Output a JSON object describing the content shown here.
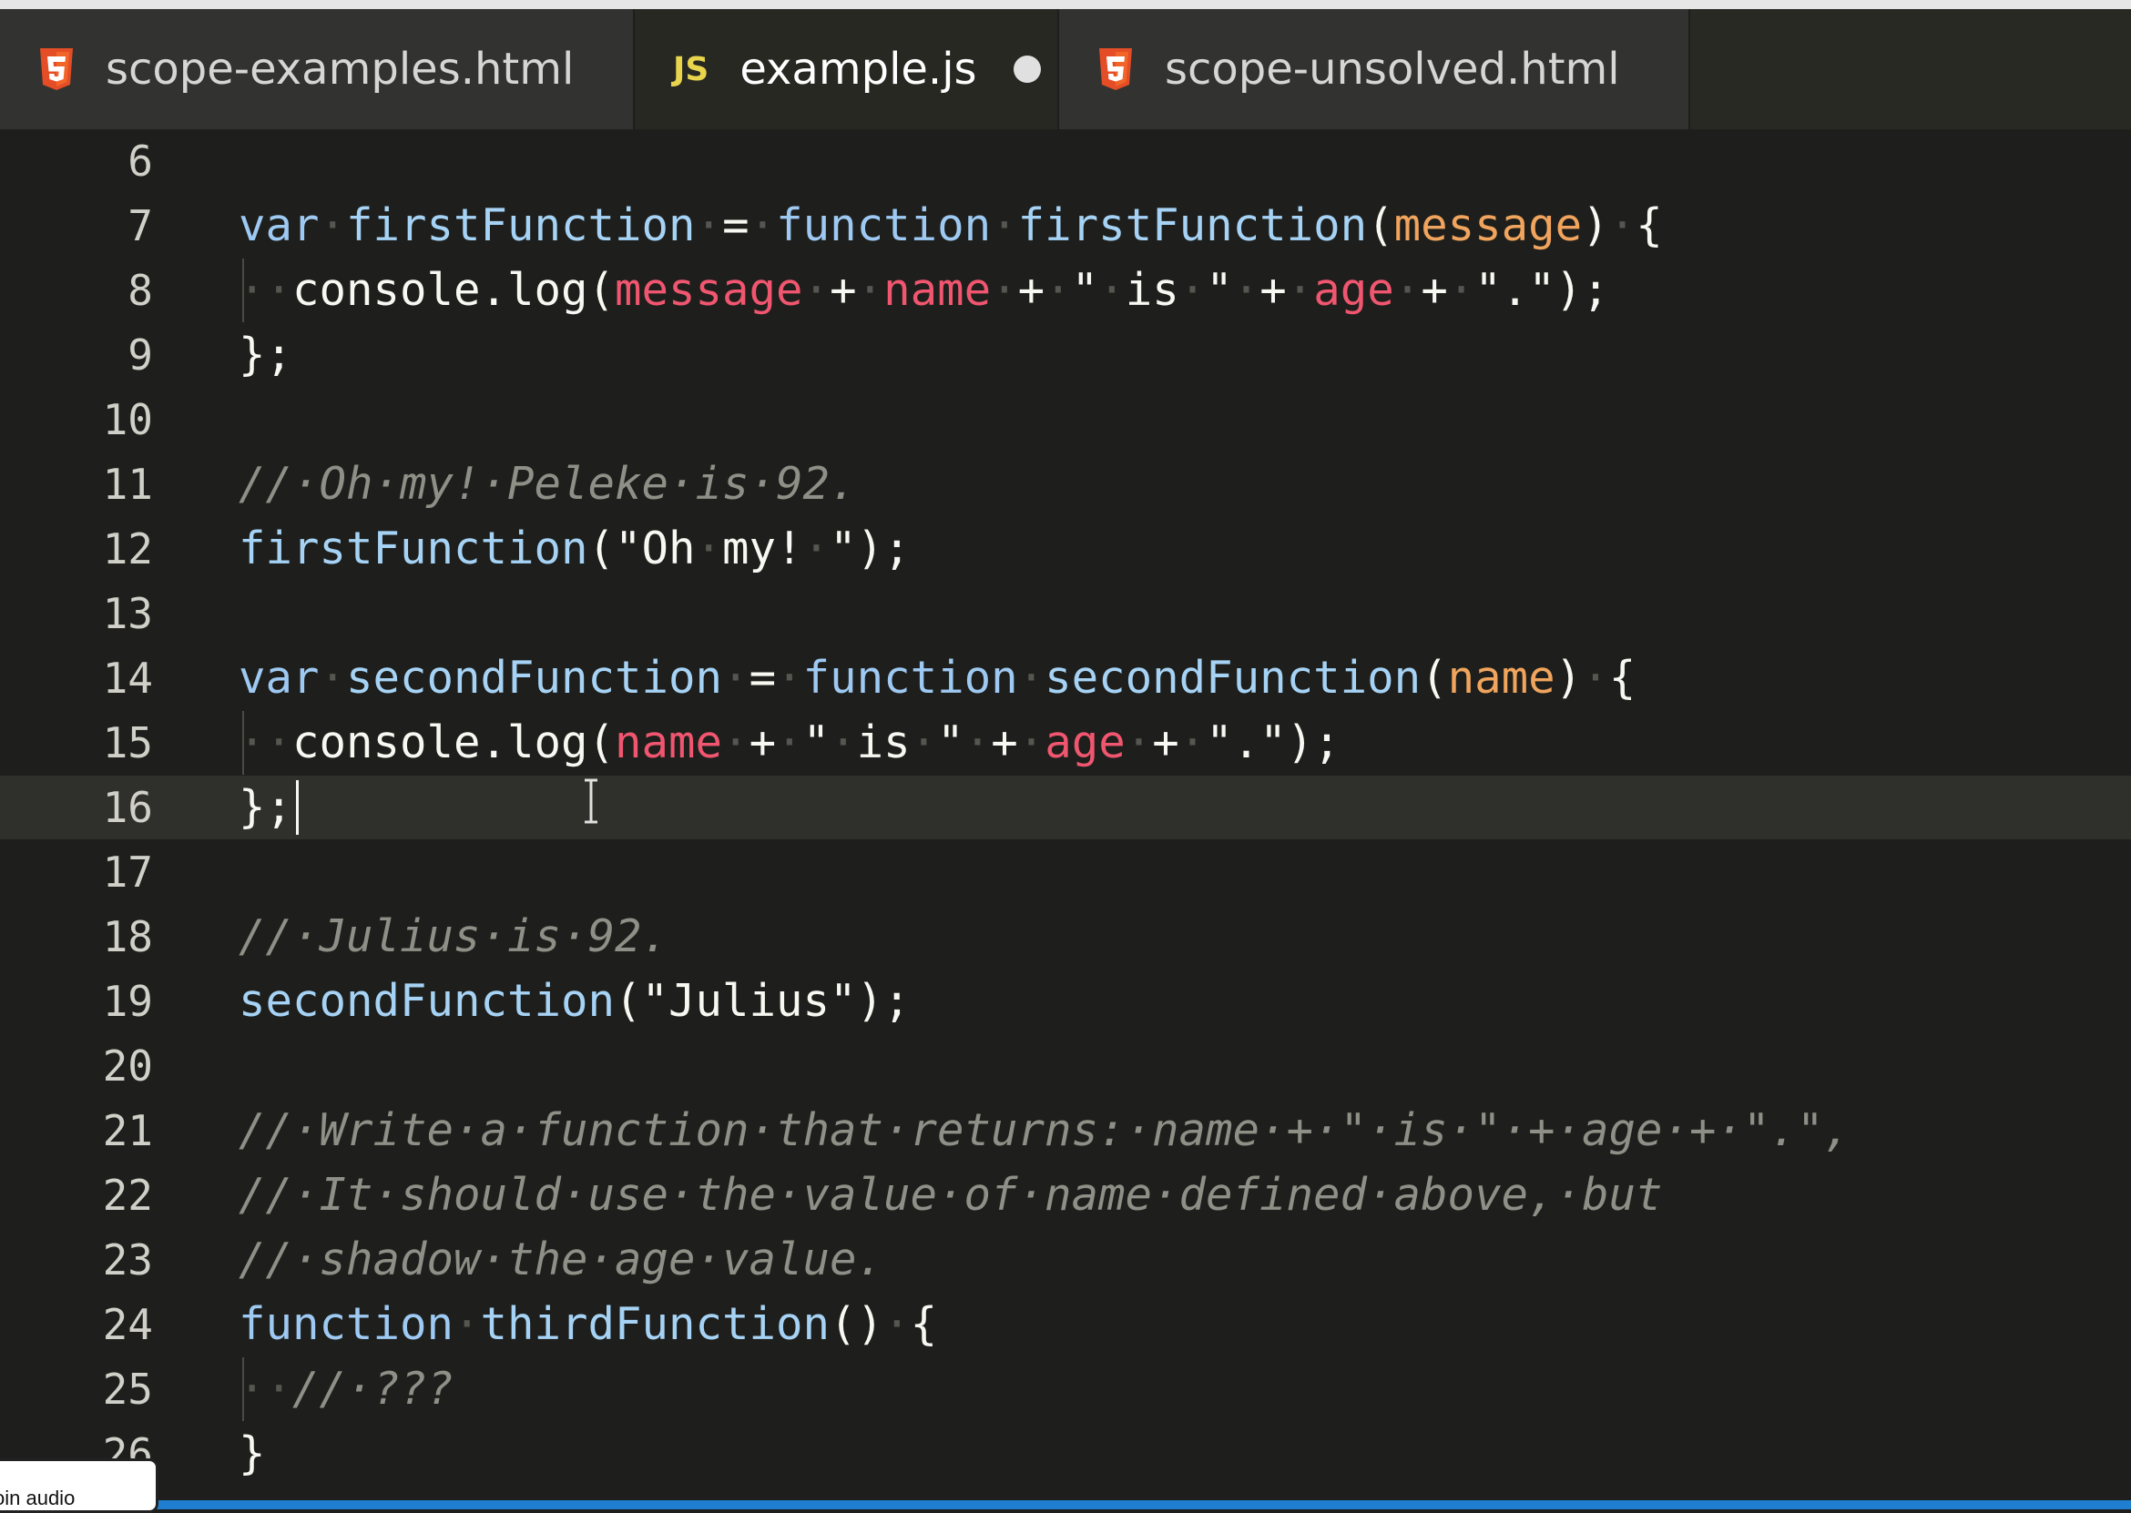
{
  "tabs": [
    {
      "label": "scope-examples.html",
      "icon": "html5-icon",
      "active": false
    },
    {
      "label": "example.js",
      "icon": "js-icon",
      "icon_text": "JS",
      "active": true,
      "unsaved": true
    },
    {
      "label": "scope-unsolved.html",
      "icon": "html5-icon",
      "active": false
    }
  ],
  "editor": {
    "current_line": 16,
    "lines": [
      {
        "n": "6"
      },
      {
        "n": "7"
      },
      {
        "n": "8"
      },
      {
        "n": "9"
      },
      {
        "n": "10"
      },
      {
        "n": "11"
      },
      {
        "n": "12"
      },
      {
        "n": "13"
      },
      {
        "n": "14"
      },
      {
        "n": "15"
      },
      {
        "n": "16"
      },
      {
        "n": "17"
      },
      {
        "n": "18"
      },
      {
        "n": "19"
      },
      {
        "n": "20"
      },
      {
        "n": "21"
      },
      {
        "n": "22"
      },
      {
        "n": "23"
      },
      {
        "n": "24"
      },
      {
        "n": "25"
      },
      {
        "n": "26"
      }
    ],
    "code": {
      "l7": [
        [
          "kw",
          "var"
        ],
        [
          "ws",
          "·"
        ],
        [
          "fn",
          "firstFunction"
        ],
        [
          "ws",
          "·"
        ],
        [
          "str",
          "="
        ],
        [
          "ws",
          "·"
        ],
        [
          "kw",
          "function"
        ],
        [
          "ws",
          "·"
        ],
        [
          "fn",
          "firstFunction"
        ],
        [
          "str",
          "("
        ],
        [
          "param",
          "message"
        ],
        [
          "str",
          ")"
        ],
        [
          "ws",
          "·"
        ],
        [
          "str",
          "{"
        ]
      ],
      "l8": [
        [
          "ws",
          "··"
        ],
        [
          "str",
          "console.log("
        ],
        [
          "var",
          "message"
        ],
        [
          "ws",
          "·"
        ],
        [
          "str",
          "+"
        ],
        [
          "ws",
          "·"
        ],
        [
          "var",
          "name"
        ],
        [
          "ws",
          "·"
        ],
        [
          "str",
          "+"
        ],
        [
          "ws",
          "·"
        ],
        [
          "str",
          "\""
        ],
        [
          "ws",
          "·"
        ],
        [
          "str",
          "is"
        ],
        [
          "ws",
          "·"
        ],
        [
          "str",
          "\""
        ],
        [
          "ws",
          "·"
        ],
        [
          "str",
          "+"
        ],
        [
          "ws",
          "·"
        ],
        [
          "var",
          "age"
        ],
        [
          "ws",
          "·"
        ],
        [
          "str",
          "+"
        ],
        [
          "ws",
          "·"
        ],
        [
          "str",
          "\".\");"
        ]
      ],
      "l9": [
        [
          "str",
          "};"
        ]
      ],
      "l11": [
        [
          "com",
          "//·Oh·my!·Peleke·is·92."
        ]
      ],
      "l12": [
        [
          "fn",
          "firstFunction"
        ],
        [
          "str",
          "(\"Oh"
        ],
        [
          "ws",
          "·"
        ],
        [
          "str",
          "my!"
        ],
        [
          "ws",
          "·"
        ],
        [
          "str",
          "\");"
        ]
      ],
      "l14": [
        [
          "kw",
          "var"
        ],
        [
          "ws",
          "·"
        ],
        [
          "fn",
          "secondFunction"
        ],
        [
          "ws",
          "·"
        ],
        [
          "str",
          "="
        ],
        [
          "ws",
          "·"
        ],
        [
          "kw",
          "function"
        ],
        [
          "ws",
          "·"
        ],
        [
          "fn",
          "secondFunction"
        ],
        [
          "str",
          "("
        ],
        [
          "param",
          "name"
        ],
        [
          "str",
          ")"
        ],
        [
          "ws",
          "·"
        ],
        [
          "str",
          "{"
        ]
      ],
      "l15": [
        [
          "ws",
          "··"
        ],
        [
          "str",
          "console.log("
        ],
        [
          "var",
          "name"
        ],
        [
          "ws",
          "·"
        ],
        [
          "str",
          "+"
        ],
        [
          "ws",
          "·"
        ],
        [
          "str",
          "\""
        ],
        [
          "ws",
          "·"
        ],
        [
          "str",
          "is"
        ],
        [
          "ws",
          "·"
        ],
        [
          "str",
          "\""
        ],
        [
          "ws",
          "·"
        ],
        [
          "str",
          "+"
        ],
        [
          "ws",
          "·"
        ],
        [
          "var",
          "age"
        ],
        [
          "ws",
          "·"
        ],
        [
          "str",
          "+"
        ],
        [
          "ws",
          "·"
        ],
        [
          "str",
          "\".\");"
        ]
      ],
      "l16": [
        [
          "str",
          "};"
        ]
      ],
      "l18": [
        [
          "com",
          "//·Julius·is·92."
        ]
      ],
      "l19": [
        [
          "fn",
          "secondFunction"
        ],
        [
          "str",
          "(\"Julius\");"
        ]
      ],
      "l21": [
        [
          "com",
          "//·Write·a·function·that·returns:·name·+·\"·is·\"·+·age·+·\".\","
        ]
      ],
      "l22": [
        [
          "com",
          "//·It·should·use·the·value·of·name·defined·above,·but"
        ]
      ],
      "l23": [
        [
          "com",
          "//·shadow·the·age·value."
        ]
      ],
      "l24": [
        [
          "kw",
          "function"
        ],
        [
          "ws",
          "·"
        ],
        [
          "fn",
          "thirdFunction"
        ],
        [
          "str",
          "()"
        ],
        [
          "ws",
          "·"
        ],
        [
          "str",
          "{"
        ]
      ],
      "l25": [
        [
          "ws",
          "··"
        ],
        [
          "com",
          "//·???"
        ]
      ],
      "l26": [
        [
          "str",
          "}"
        ]
      ]
    }
  },
  "popup": {
    "text": "oin audio"
  },
  "colors": {
    "accent_status": "#1f7ecf",
    "html5_icon": "#e44d26",
    "js_icon": "#e8d44d"
  }
}
